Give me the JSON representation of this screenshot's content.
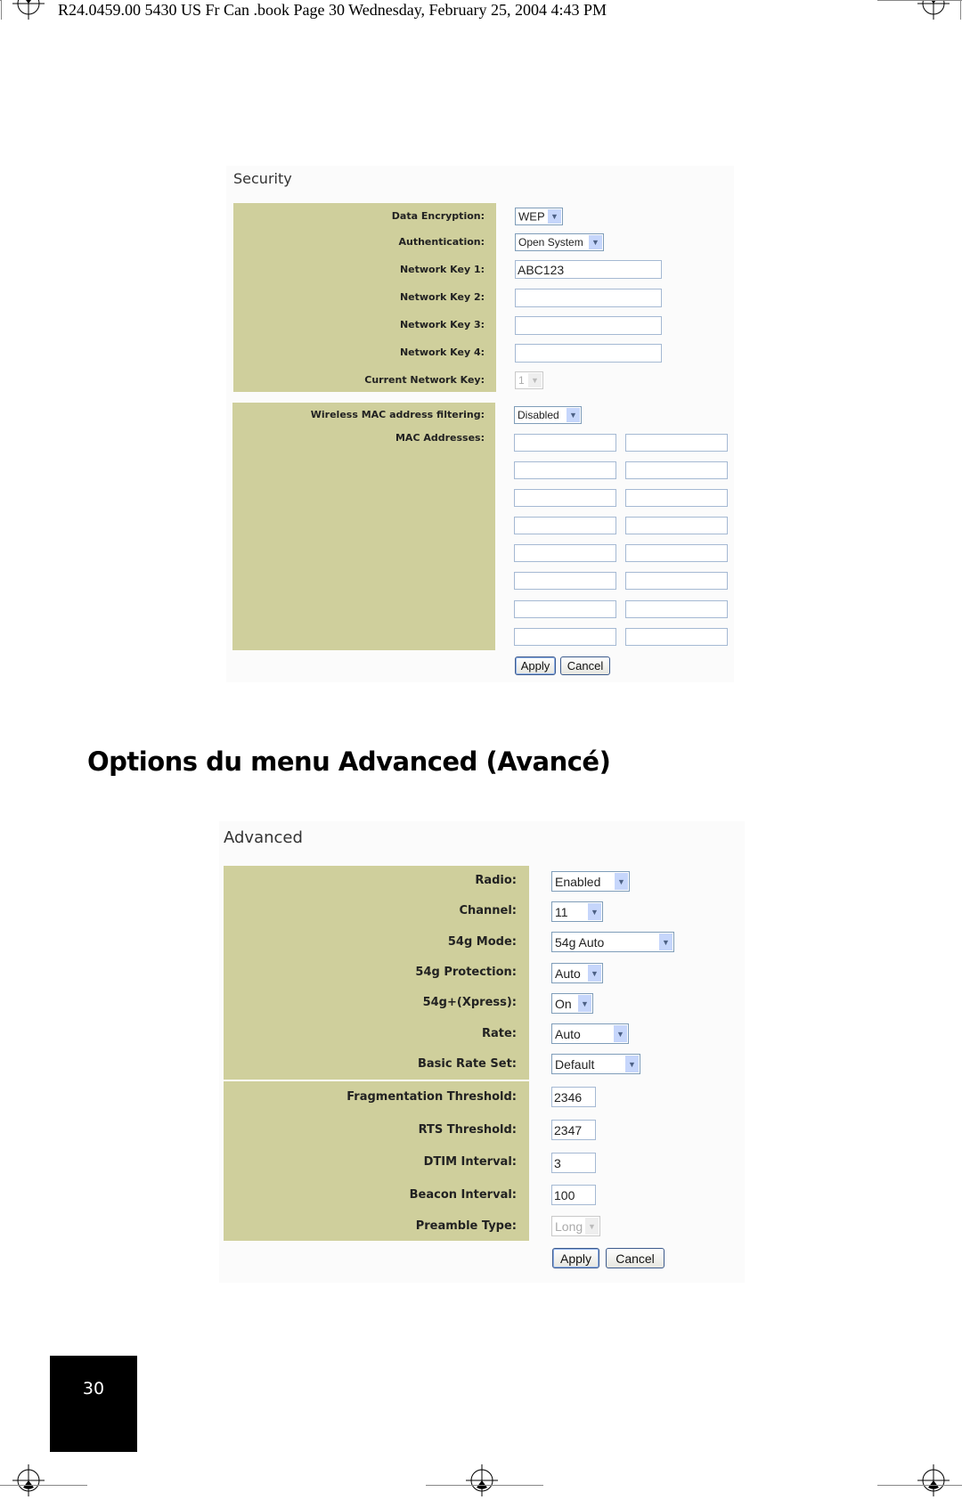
{
  "header": {
    "text": "R24.0459.00 5430 US Fr Can .book  Page 30  Wednesday, February 25, 2004  4:43 PM"
  },
  "security": {
    "title": "Security",
    "fields": [
      {
        "label": "Data Encryption:",
        "type": "select",
        "value": "WEP"
      },
      {
        "label": "Authentication:",
        "type": "select",
        "value": "Open System"
      },
      {
        "label": "Network Key 1:",
        "type": "text",
        "value": "ABC123"
      },
      {
        "label": "Network Key 2:",
        "type": "text",
        "value": ""
      },
      {
        "label": "Network Key 3:",
        "type": "text",
        "value": ""
      },
      {
        "label": "Network Key 4:",
        "type": "text",
        "value": ""
      },
      {
        "label": "Current Network Key:",
        "type": "select",
        "value": "1",
        "disabled": true
      }
    ],
    "mac_filtering": {
      "label": "Wireless MAC address filtering:",
      "value": "Disabled"
    },
    "mac_addresses": {
      "label": "MAC Addresses:",
      "values": [
        "",
        "",
        "",
        "",
        "",
        "",
        "",
        "",
        "",
        "",
        "",
        "",
        "",
        "",
        "",
        ""
      ]
    },
    "apply_label": "Apply",
    "cancel_label": "Cancel"
  },
  "section_heading": "Options du menu Advanced (Avancé)",
  "advanced": {
    "title": "Advanced",
    "selects": [
      {
        "label": "Radio:",
        "value": "Enabled"
      },
      {
        "label": "Channel:",
        "value": "11"
      },
      {
        "label": "54g Mode:",
        "value": "54g Auto"
      },
      {
        "label": "54g Protection:",
        "value": "Auto"
      },
      {
        "label": "54g+(Xpress):",
        "value": "On"
      },
      {
        "label": "Rate:",
        "value": "Auto"
      },
      {
        "label": "Basic Rate Set:",
        "value": "Default"
      }
    ],
    "inputs": [
      {
        "label": "Fragmentation Threshold:",
        "value": "2346"
      },
      {
        "label": "RTS Threshold:",
        "value": "2347"
      },
      {
        "label": "DTIM Interval:",
        "value": "3"
      },
      {
        "label": "Beacon Interval:",
        "value": "100"
      }
    ],
    "preamble": {
      "label": "Preamble Type:",
      "value": "Long",
      "disabled": true
    },
    "apply_label": "Apply",
    "cancel_label": "Cancel"
  },
  "footer": {
    "page_number": "30"
  },
  "colors": {
    "panel": "#cfcf9c",
    "input_border": "#7f9db9",
    "arrow_bg": "#c6d6fb",
    "page_box": "#000000"
  }
}
